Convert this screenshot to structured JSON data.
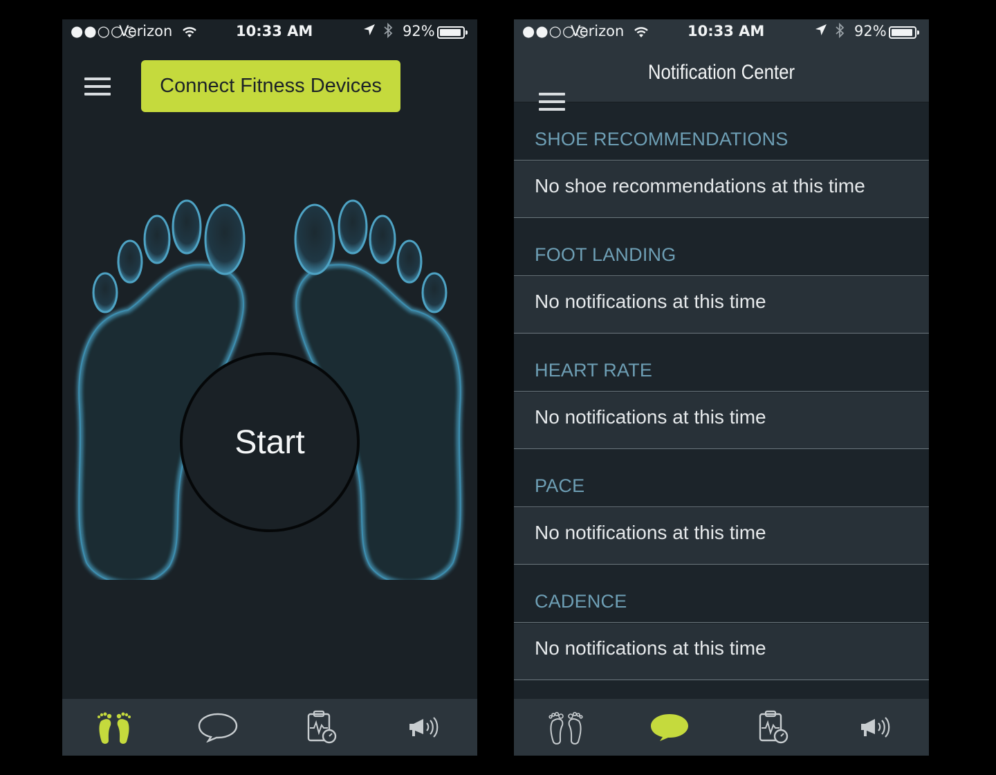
{
  "status_bar": {
    "signal": "●●○○○",
    "carrier": "Verizon",
    "time": "10:33 AM",
    "battery": "92%"
  },
  "home": {
    "connect_label": "Connect Fitness Devices",
    "start_label": "Start"
  },
  "notifications": {
    "title": "Notification Center",
    "sections": [
      {
        "header": "SHOE RECOMMENDATIONS",
        "message": "No shoe recommendations at this time"
      },
      {
        "header": "FOOT LANDING",
        "message": "No notifications at this time"
      },
      {
        "header": "HEART RATE",
        "message": "No notifications at this time"
      },
      {
        "header": "PACE",
        "message": "No notifications at this time"
      },
      {
        "header": "CADENCE",
        "message": "No notifications at this time"
      }
    ]
  },
  "tabs": {
    "icons": [
      "feet-icon",
      "chat-bubble-icon",
      "clipboard-activity-icon",
      "megaphone-icon"
    ],
    "left_active": "feet-icon",
    "right_active": "chat-bubble-icon"
  },
  "colors": {
    "accent": "#c5da3d",
    "background": "#1a2126",
    "bar": "#2c353c",
    "section_header": "#6e9fb5",
    "foot_glow": "#4ea3c4"
  }
}
